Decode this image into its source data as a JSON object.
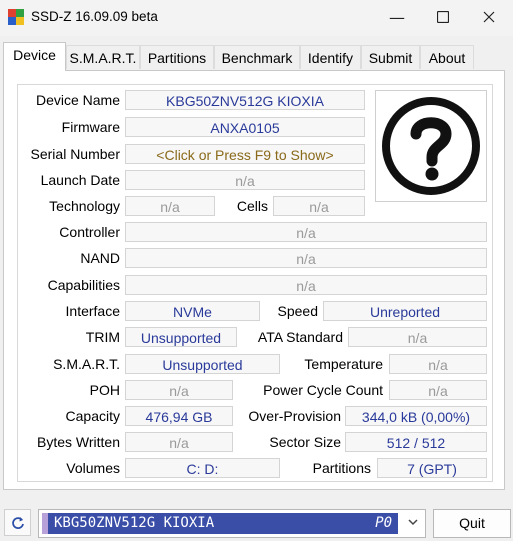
{
  "window": {
    "title": "SSD-Z 16.09.09 beta"
  },
  "tabs": [
    "Device",
    "S.M.A.R.T.",
    "Partitions",
    "Benchmark",
    "Identify",
    "Submit",
    "About"
  ],
  "device": {
    "device_name": {
      "label": "Device Name",
      "value": "KBG50ZNV512G KIOXIA"
    },
    "firmware": {
      "label": "Firmware",
      "value": "ANXA0105"
    },
    "serial_number": {
      "label": "Serial Number",
      "value": "<Click or Press F9 to Show>"
    },
    "launch_date": {
      "label": "Launch Date",
      "value": "n/a"
    },
    "technology": {
      "label": "Technology",
      "value": "n/a"
    },
    "cells": {
      "label": "Cells",
      "value": "n/a"
    },
    "controller": {
      "label": "Controller",
      "value": "n/a"
    },
    "nand": {
      "label": "NAND",
      "value": "n/a"
    },
    "capabilities": {
      "label": "Capabilities",
      "value": "n/a"
    },
    "interface": {
      "label": "Interface",
      "value": "NVMe"
    },
    "speed": {
      "label": "Speed",
      "value": "Unreported"
    },
    "trim": {
      "label": "TRIM",
      "value": "Unsupported"
    },
    "ata_standard": {
      "label": "ATA Standard",
      "value": "n/a"
    },
    "smart": {
      "label": "S.M.A.R.T.",
      "value": "Unsupported"
    },
    "temperature": {
      "label": "Temperature",
      "value": "n/a"
    },
    "poh": {
      "label": "POH",
      "value": "n/a"
    },
    "power_cycle_count": {
      "label": "Power Cycle Count",
      "value": "n/a"
    },
    "capacity": {
      "label": "Capacity",
      "value": "476,94 GB"
    },
    "over_provision": {
      "label": "Over-Provision",
      "value": "344,0 kB (0,00%)"
    },
    "bytes_written": {
      "label": "Bytes Written",
      "value": "n/a"
    },
    "sector_size": {
      "label": "Sector Size",
      "value": "512 / 512"
    },
    "volumes": {
      "label": "Volumes",
      "value": "C:  D:"
    },
    "partitions": {
      "label": "Partitions",
      "value": "7 (GPT)"
    }
  },
  "footer": {
    "drive_name": "KBG50ZNV512G KIOXIA",
    "drive_index": "P0",
    "quit_label": "Quit"
  },
  "icons": {
    "app": "ssd-z-app-icon",
    "unknown_drive": "question-mark-icon",
    "refresh": "refresh-icon"
  },
  "colors": {
    "value_text": "#2a3a9a",
    "na_text": "#9a9a9a",
    "selection": "#3a4ea8"
  }
}
